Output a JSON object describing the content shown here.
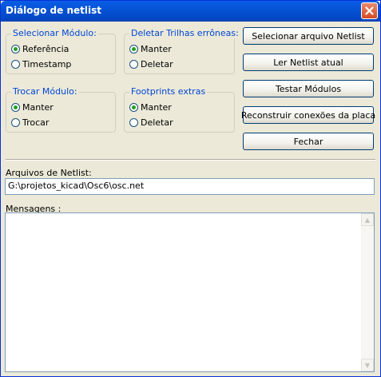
{
  "window": {
    "title": "Diálogo de netlist"
  },
  "groups": {
    "select_module": {
      "title": "Selecionar Módulo:",
      "options": [
        "Referência",
        "Timestamp"
      ],
      "selected": "Referência"
    },
    "delete_tracks": {
      "title": "Deletar Trilhas errôneas:",
      "options": [
        "Manter",
        "Deletar"
      ],
      "selected": "Manter"
    },
    "change_module": {
      "title": "Trocar Módulo:",
      "options": [
        "Manter",
        "Trocar"
      ],
      "selected": "Manter"
    },
    "extra_footprints": {
      "title": "Footprints extras",
      "options": [
        "Manter",
        "Deletar"
      ],
      "selected": "Manter"
    }
  },
  "buttons": {
    "select_netlist": "Selecionar arquivo Netlist",
    "read_netlist": "Ler Netlist atual",
    "test_modules": "Testar Módulos",
    "rebuild_connections": "Reconstruir conexões da placa",
    "close": "Fechar"
  },
  "netlist_files": {
    "label": "Arquivos de Netlist:",
    "value": "G:\\projetos_kicad\\Osc6\\osc.net"
  },
  "messages": {
    "label": "Mensagens :",
    "value": ""
  },
  "icons": {
    "close": "close-icon",
    "scroll_up": "arrow-up-icon",
    "scroll_down": "arrow-down-icon"
  },
  "colors": {
    "titlebar": "#0553d6",
    "group_title": "#0046d5",
    "dialog_bg": "#ece9d8",
    "close_button": "#d54b22"
  }
}
